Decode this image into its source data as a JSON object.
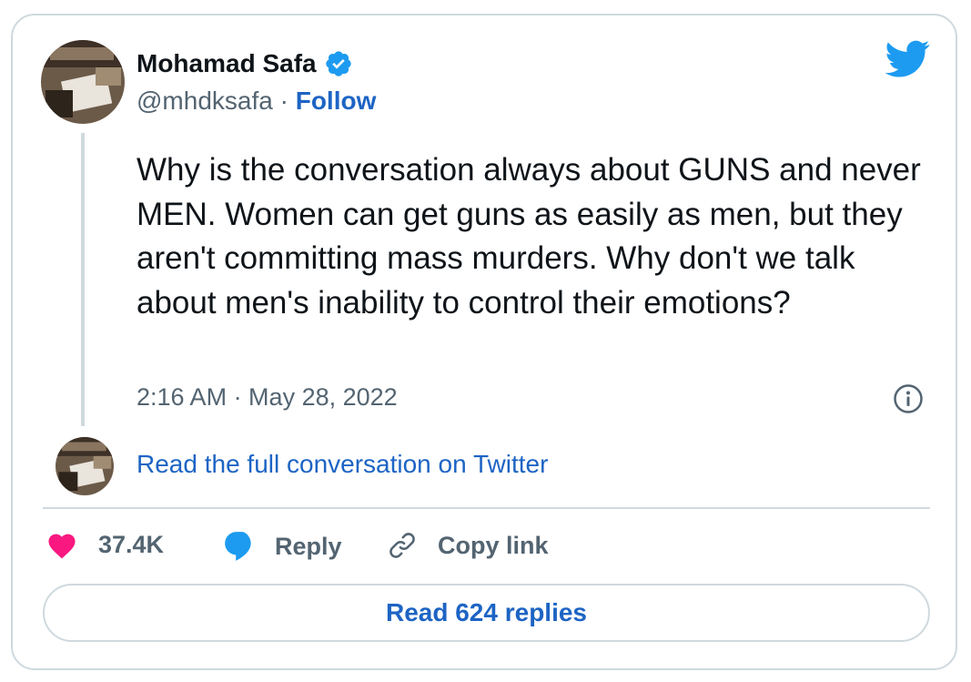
{
  "author": {
    "name": "Mohamad Safa",
    "handle": "@mhdksafa",
    "separator": "·",
    "follow_label": "Follow"
  },
  "tweet": {
    "text": "Why is the conversation always about GUNS and never MEN. Women can get guns as easily as men, but they aren't committing mass murders. Why don't we talk about men's inability to control their emotions?",
    "timestamp": "2:16 AM · May 28, 2022"
  },
  "conversation_link": "Read the full conversation on Twitter",
  "actions": {
    "likes_count": "37.4K",
    "reply_label": "Reply",
    "copy_link_label": "Copy link"
  },
  "replies_button": "Read 624 replies",
  "colors": {
    "link": "#1d64c4",
    "twitter_blue": "#1d9bf0",
    "like_pink": "#f91880",
    "border": "#cfd9de",
    "secondary_text": "#536471"
  },
  "icons": {
    "logo": "twitter-bird-icon",
    "verified": "verified-badge-icon",
    "info": "info-icon",
    "like": "heart-icon",
    "reply": "speech-bubble-icon",
    "copy": "link-icon"
  }
}
